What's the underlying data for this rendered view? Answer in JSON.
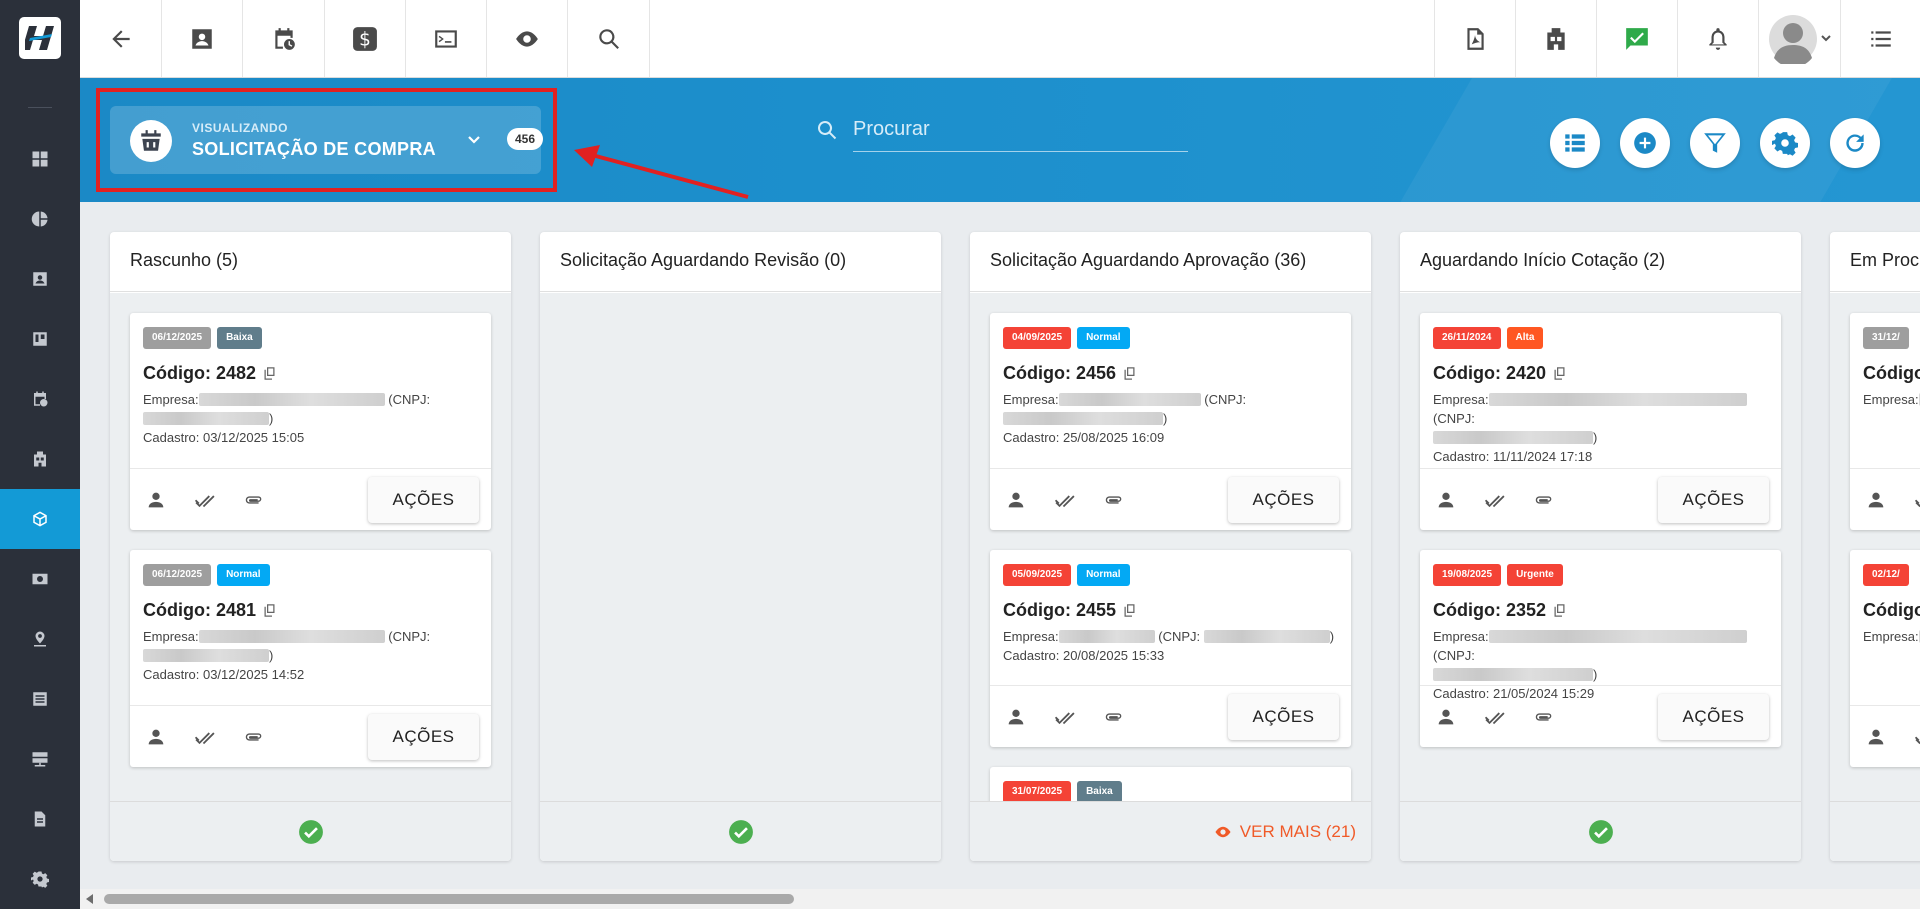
{
  "header": {
    "viewing_caption": "VISUALIZANDO",
    "view_title": "SOLICITAÇÃO DE COMPRA",
    "view_count": "456",
    "search_placeholder": "Procurar"
  },
  "columns": [
    {
      "title": "Rascunho (5)",
      "footer": "ok",
      "cards": [
        {
          "date": "06/12/2025",
          "date_color": "#9e9e9e",
          "priority": "Baixa",
          "priority_color": "#607d8b",
          "code": "Código: 2482",
          "empresa_label": "Empresa:",
          "cnpj_label": "(CNPJ:",
          "cnpj_close": ")",
          "cadastro": "Cadastro: 03/12/2025 15:05"
        },
        {
          "date": "06/12/2025",
          "date_color": "#9e9e9e",
          "priority": "Normal",
          "priority_color": "#03a9f4",
          "code": "Código: 2481",
          "empresa_label": "Empresa:",
          "cnpj_label": "(CNPJ:",
          "cnpj_close": ")",
          "cadastro": "Cadastro: 03/12/2025 14:52"
        }
      ]
    },
    {
      "title": "Solicitação Aguardando Revisão (0)",
      "footer": "ok",
      "cards": []
    },
    {
      "title": "Solicitação Aguardando Aprovação (36)",
      "footer": "more",
      "see_more": "VER MAIS (21)",
      "cards": [
        {
          "date": "04/09/2025",
          "date_color": "#f44336",
          "priority": "Normal",
          "priority_color": "#03a9f4",
          "code": "Código: 2456",
          "empresa_label": "Empresa:",
          "cnpj_label": "(CNPJ:",
          "cnpj_close": ")",
          "cadastro": "Cadastro: 25/08/2025 16:09"
        },
        {
          "date": "05/09/2025",
          "date_color": "#f44336",
          "priority": "Normal",
          "priority_color": "#03a9f4",
          "code": "Código: 2455",
          "empresa_label": "Empresa:",
          "cnpj_label": "(CNPJ:",
          "cnpj_close": ")",
          "cadastro": "Cadastro: 20/08/2025 15:33"
        },
        {
          "date": "31/07/2025",
          "date_color": "#f44336",
          "priority": "Baixa",
          "priority_color": "#607d8b"
        }
      ]
    },
    {
      "title": "Aguardando Início Cotação (2)",
      "footer": "ok",
      "cards": [
        {
          "date": "26/11/2024",
          "date_color": "#f44336",
          "priority": "Alta",
          "priority_color": "#ff5722",
          "code": "Código: 2420",
          "empresa_label": "Empresa:",
          "cnpj_label": "(CNPJ:",
          "cnpj_close": ")",
          "cadastro": "Cadastro: 11/11/2024 17:18"
        },
        {
          "date": "19/08/2025",
          "date_color": "#f44336",
          "priority": "Urgente",
          "priority_color": "#f44336",
          "code": "Código: 2352",
          "empresa_label": "Empresa:",
          "cnpj_label": "(CNPJ:",
          "cnpj_close": ")",
          "cadastro": "Cadastro: 21/05/2024 15:29"
        }
      ]
    },
    {
      "title": "Em Proc",
      "footer": "ok",
      "cards": [
        {
          "date": "31/12/",
          "date_color": "#9e9e9e",
          "code": "Código:",
          "empresa_label": "Empresa:"
        },
        {
          "date": "02/12/",
          "date_color": "#f44336",
          "code": "Código:",
          "empresa_label": "Empresa:"
        }
      ]
    }
  ],
  "labels": {
    "actions": "AÇÕES"
  },
  "colors": {
    "brand_blue": "#1b89c6",
    "sidebar_bg": "#2b303a",
    "sidebar_active": "#139ad6",
    "highlight_red": "#e12121",
    "success_green": "#4caf50",
    "see_more_orange": "#f05a28"
  },
  "icons": {
    "sidebar": [
      "dashboard-icon",
      "pie-chart-icon",
      "contact-card-icon",
      "kanban-icon",
      "calendar-clock-icon",
      "building-icon",
      "package-icon",
      "money-icon",
      "location-icon",
      "list-icon",
      "server-icon",
      "document-icon",
      "gear-icon"
    ],
    "topbar_left": [
      "back-arrow-icon",
      "contact-card-icon",
      "calendar-clock-icon",
      "dollar-icon",
      "terminal-icon",
      "eye-icon",
      "search-icon"
    ],
    "topbar_right": [
      "pdf-icon",
      "building-icon",
      "check-chat-icon",
      "bell-icon",
      "avatar",
      "menu-list-icon"
    ],
    "header_actions": [
      "list-view-icon",
      "add-icon",
      "filter-icon",
      "gear-icon",
      "refresh-icon"
    ]
  }
}
